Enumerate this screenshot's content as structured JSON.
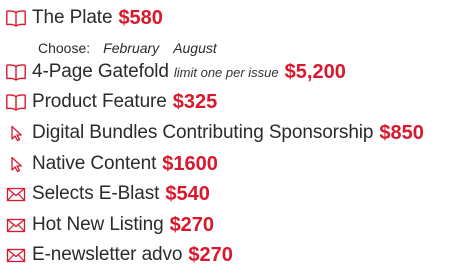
{
  "items": [
    {
      "icon": "open-book-icon",
      "label": "The Plate",
      "note": "",
      "price": "$580"
    },
    {
      "icon": "open-book-icon",
      "label": "4-Page Gatefold",
      "note": "limit one per issue",
      "price": "$5,200"
    },
    {
      "icon": "open-book-icon",
      "label": "Product Feature",
      "note": "",
      "price": "$325"
    },
    {
      "icon": "cursor-arrow-icon",
      "label": "Digital Bundles Contributing Sponsorship",
      "note": "",
      "price": "$850"
    },
    {
      "icon": "cursor-arrow-icon",
      "label": "Native Content",
      "note": "",
      "price": "$1600"
    },
    {
      "icon": "envelope-icon",
      "label": "Selects E-Blast",
      "note": "",
      "price": "$540"
    },
    {
      "icon": "envelope-icon",
      "label": "Hot New Listing",
      "note": "",
      "price": "$270"
    },
    {
      "icon": "envelope-icon",
      "label": "E-newsletter advo",
      "note": "",
      "price": "$270"
    }
  ],
  "choose": {
    "label": "Choose:",
    "options": [
      "February",
      "August"
    ]
  },
  "colors": {
    "price": "#d9182d",
    "icon": "#d9182d",
    "text": "#2b2b2b"
  }
}
